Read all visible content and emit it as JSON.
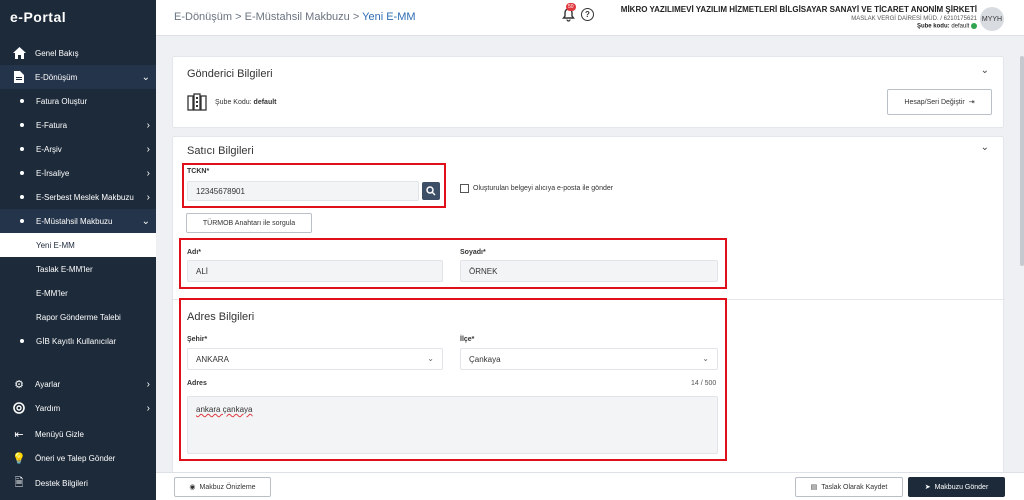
{
  "app": {
    "logo": "e-Portal"
  },
  "sidebar": {
    "items": [
      {
        "label": "Genel Bakış",
        "icon": "home-icon"
      },
      {
        "label": "E-Dönüşüm",
        "icon": "document-icon"
      },
      {
        "label": "Fatura Oluştur"
      },
      {
        "label": "E-Fatura"
      },
      {
        "label": "E-Arşiv"
      },
      {
        "label": "E-İrsaliye"
      },
      {
        "label": "E-Serbest Meslek Makbuzu"
      },
      {
        "label": "E-Müstahsil Makbuzu"
      },
      {
        "label": "Yeni E-MM"
      },
      {
        "label": "Taslak E-MM'ler"
      },
      {
        "label": "E-MM'ler"
      },
      {
        "label": "Rapor Gönderme Talebi"
      },
      {
        "label": "GİB Kayıtlı Kullanıcılar"
      },
      {
        "label": "Ayarlar",
        "icon": "gear-icon"
      },
      {
        "label": "Yardım",
        "icon": "lifebuoy-icon"
      },
      {
        "label": "Menüyü Gizle",
        "icon": "collapse-icon"
      },
      {
        "label": "Öneri ve Talep Gönder",
        "icon": "lightbulb-icon"
      },
      {
        "label": "Destek Bilgileri",
        "icon": "support-icon"
      }
    ]
  },
  "header": {
    "breadcrumb": {
      "p1": "E-Dönüşüm",
      "p2": "E-Müstahsil Makbuzu",
      "current": "Yeni E-MM",
      "sep": ">"
    },
    "notification_count": "50",
    "company_name": "MİKRO YAZILIMEVİ YAZILIM HİZMETLERİ BİLGİSAYAR SANAYİ VE TİCARET ANONİM ŞİRKETİ",
    "tax_office": "MASLAK VERGİ DAİRESİ MÜD. / 6210175621",
    "branch_label": "Şube kodu:",
    "branch_value": "default",
    "avatar": "MYYH"
  },
  "sender": {
    "title": "Gönderici Bilgileri",
    "branch_label": "Şube Kodu:",
    "branch_value": "default",
    "change_button": "Hesap/Seri Değiştir"
  },
  "seller": {
    "title": "Satıcı Bilgileri",
    "tckn_label": "TCKN*",
    "tckn_value": "12345678901",
    "email_checkbox": "Oluşturulan belgeyi alıcıya e-posta ile gönder",
    "turmob_button": "TÜRMOB Anahtarı ile sorgula",
    "name_label": "Adı*",
    "name_value": "ALİ",
    "surname_label": "Soyadı*",
    "surname_value": "ÖRNEK"
  },
  "address": {
    "title": "Adres Bilgileri",
    "city_label": "Şehir*",
    "city_value": "ANKARA",
    "district_label": "İlçe*",
    "district_value": "Çankaya",
    "address_label": "Adres",
    "counter": "14 / 500",
    "address_value": "ankara çankaya"
  },
  "footer": {
    "preview_button": "Makbuz Önizleme",
    "draft_button": "Taslak Olarak Kaydet",
    "send_button": "Makbuzu Gönder"
  },
  "colors": {
    "sidebar": "#1d2a3a",
    "accent": "#2d6cb3",
    "highlight": "#e0101a",
    "primary_button": "#1d2a3a"
  }
}
